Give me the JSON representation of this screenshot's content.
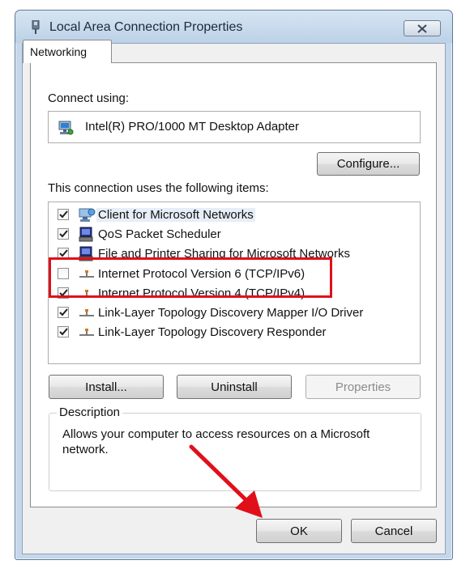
{
  "window": {
    "title": "Local Area Connection Properties",
    "close_glyph": "✕"
  },
  "tabs": [
    {
      "label": "Networking",
      "active": true
    }
  ],
  "connect_using": {
    "label": "Connect using:",
    "adapter": "Intel(R) PRO/1000 MT Desktop Adapter",
    "configure_button": "Configure..."
  },
  "items": {
    "label": "This connection uses the following items:",
    "list": [
      {
        "label": "Client for Microsoft Networks",
        "checked": true,
        "icon": "client-icon",
        "selected": true
      },
      {
        "label": "QoS Packet Scheduler",
        "checked": true,
        "icon": "service-icon",
        "selected": false
      },
      {
        "label": "File and Printer Sharing for Microsoft Networks",
        "checked": true,
        "icon": "service-icon",
        "selected": false
      },
      {
        "label": "Internet Protocol Version 6 (TCP/IPv6)",
        "checked": false,
        "icon": "protocol-icon",
        "selected": false
      },
      {
        "label": "Internet Protocol Version 4 (TCP/IPv4)",
        "checked": true,
        "icon": "protocol-icon",
        "selected": false
      },
      {
        "label": "Link-Layer Topology Discovery Mapper I/O Driver",
        "checked": true,
        "icon": "protocol-icon",
        "selected": false
      },
      {
        "label": "Link-Layer Topology Discovery Responder",
        "checked": true,
        "icon": "protocol-icon",
        "selected": false
      }
    ]
  },
  "buttons": {
    "install": "Install...",
    "uninstall": "Uninstall",
    "properties": "Properties",
    "ok": "OK",
    "cancel": "Cancel"
  },
  "description": {
    "legend": "Description",
    "text": "Allows your computer to access resources on a Microsoft network."
  },
  "colors": {
    "annotation": "#e0101a",
    "window_frame": "#c5d7ea"
  }
}
